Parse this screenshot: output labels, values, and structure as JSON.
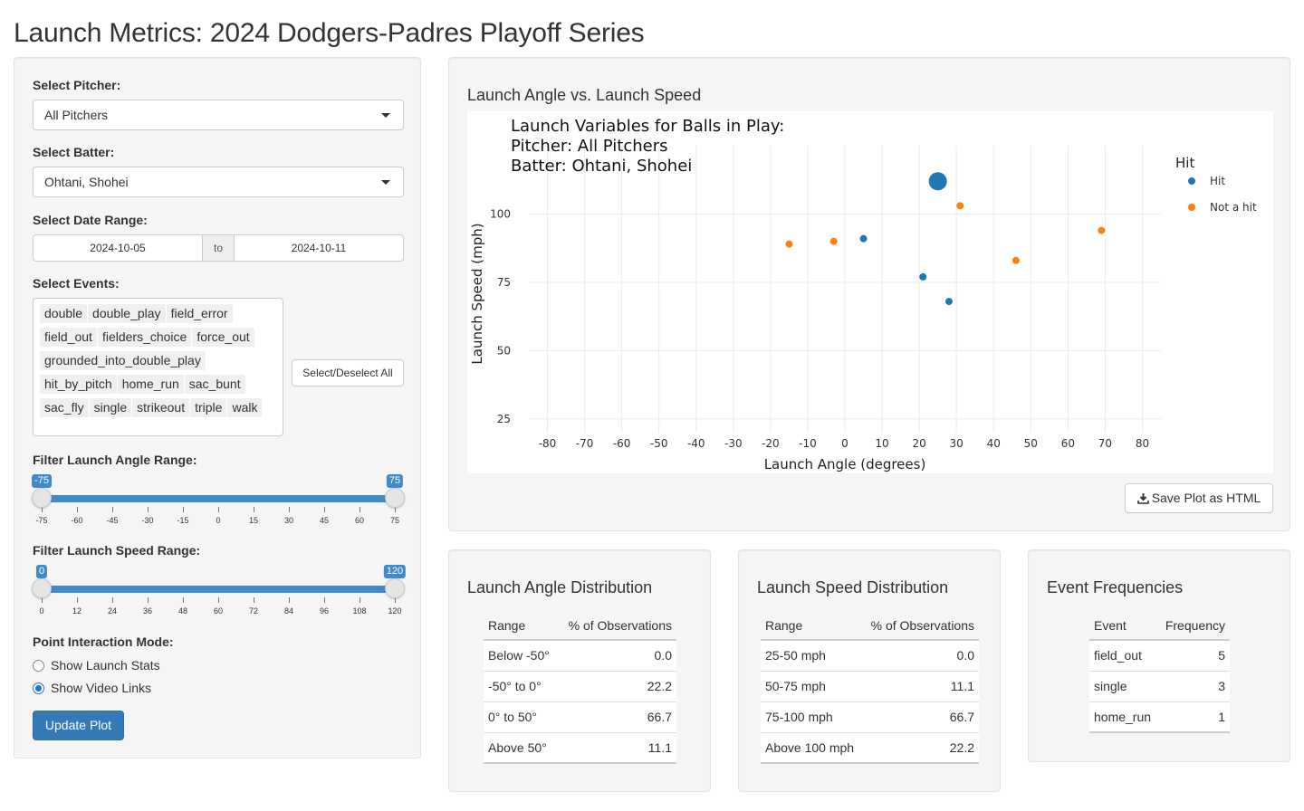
{
  "page_title": "Launch Metrics: 2024 Dodgers-Padres Playoff Series",
  "sidebar": {
    "pitcher_label": "Select Pitcher:",
    "pitcher_value": "All Pitchers",
    "batter_label": "Select Batter:",
    "batter_value": "Ohtani, Shohei",
    "date_label": "Select Date Range:",
    "date_start": "2024-10-05",
    "date_sep": "to",
    "date_end": "2024-10-11",
    "events_label": "Select Events:",
    "events": [
      "double",
      "double_play",
      "field_error",
      "field_out",
      "fielders_choice",
      "force_out",
      "grounded_into_double_play",
      "hit_by_pitch",
      "home_run",
      "sac_bunt",
      "sac_fly",
      "single",
      "strikeout",
      "triple",
      "walk"
    ],
    "select_all_label": "Select/Deselect All",
    "angle_label": "Filter Launch Angle Range:",
    "angle_slider": {
      "min": -75,
      "max": 75,
      "low": -75,
      "high": 75,
      "low_label": "-75",
      "high_label": "75",
      "ticks": [
        "-75",
        "-60",
        "-45",
        "-30",
        "-15",
        "0",
        "15",
        "30",
        "45",
        "60",
        "75"
      ]
    },
    "speed_label": "Filter Launch Speed Range:",
    "speed_slider": {
      "min": 0,
      "max": 120,
      "low": 0,
      "high": 120,
      "low_label": "0",
      "high_label": "120",
      "ticks": [
        "0",
        "12",
        "24",
        "36",
        "48",
        "60",
        "72",
        "84",
        "96",
        "108",
        "120"
      ]
    },
    "mode_label": "Point Interaction Mode:",
    "mode_options": [
      "Show Launch Stats",
      "Show Video Links"
    ],
    "mode_selected": "Show Video Links",
    "update_label": "Update Plot"
  },
  "plot_panel": {
    "heading": "Launch Angle vs. Launch Speed",
    "save_label": "Save Plot as HTML"
  },
  "chart_data": {
    "type": "scatter",
    "title_lines": [
      "Launch Variables for Balls in Play:",
      "Pitcher: All Pitchers",
      "Batter: Ohtani, Shohei"
    ],
    "xlabel": "Launch Angle (degrees)",
    "ylabel": "Launch Speed (mph)",
    "xlim": [
      -85,
      85
    ],
    "ylim": [
      20,
      125
    ],
    "xticks": [
      -80,
      -70,
      -60,
      -50,
      -40,
      -30,
      -20,
      -10,
      0,
      10,
      20,
      30,
      40,
      50,
      60,
      70,
      80
    ],
    "yticks": [
      25,
      50,
      75,
      100
    ],
    "grid": true,
    "legend_title": "Hit",
    "legend_position": "right",
    "series": [
      {
        "name": "Hit",
        "color": "#1f77b4",
        "points": [
          {
            "x": 25,
            "y": 112,
            "big": true
          },
          {
            "x": 5,
            "y": 91
          },
          {
            "x": 21,
            "y": 77
          },
          {
            "x": 28,
            "y": 68
          }
        ]
      },
      {
        "name": "Not a hit",
        "color": "#ff7f0e",
        "points": [
          {
            "x": -15,
            "y": 89
          },
          {
            "x": -3,
            "y": 90
          },
          {
            "x": 31,
            "y": 103
          },
          {
            "x": 46,
            "y": 83
          },
          {
            "x": 69,
            "y": 94
          }
        ]
      }
    ]
  },
  "angle_dist": {
    "heading": "Launch Angle Distribution",
    "headers": [
      "Range",
      "% of Observations"
    ],
    "rows": [
      [
        "Below -50°",
        "0.0"
      ],
      [
        "-50° to 0°",
        "22.2"
      ],
      [
        "0° to 50°",
        "66.7"
      ],
      [
        "Above 50°",
        "11.1"
      ]
    ]
  },
  "speed_dist": {
    "heading": "Launch Speed Distribution",
    "headers": [
      "Range",
      "% of Observations"
    ],
    "rows": [
      [
        "25-50 mph",
        "0.0"
      ],
      [
        "50-75 mph",
        "11.1"
      ],
      [
        "75-100 mph",
        "66.7"
      ],
      [
        "Above 100 mph",
        "22.2"
      ]
    ]
  },
  "event_freq": {
    "heading": "Event Frequencies",
    "headers": [
      "Event",
      "Frequency"
    ],
    "rows": [
      [
        "field_out",
        "5"
      ],
      [
        "single",
        "3"
      ],
      [
        "home_run",
        "1"
      ]
    ]
  }
}
